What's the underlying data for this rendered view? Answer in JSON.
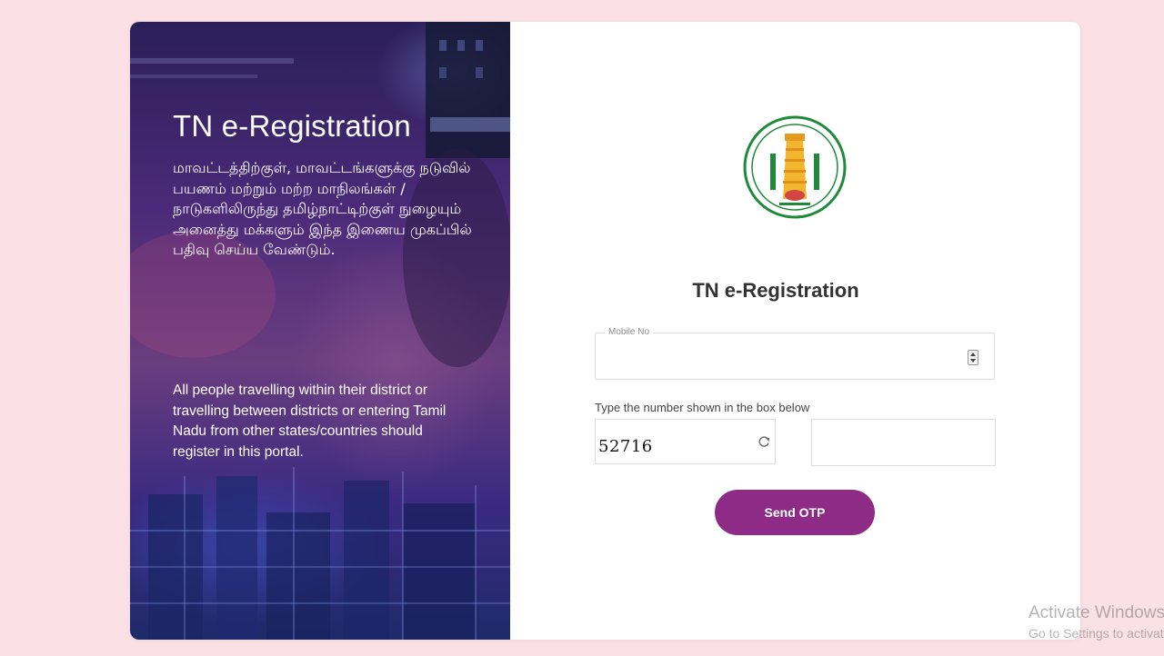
{
  "hero": {
    "title": "TN e-Registration",
    "tamil_text": "மாவட்டத்திற்குள், மாவட்டங்களுக்கு நடுவில் பயணம் மற்றும் மற்ற மாநிலங்கள் / நாடுகளிலிருந்து தமிழ்நாட்டிற்குள் நுழையும் அனைத்து மக்களும் இந்த இணைய முகப்பில் பதிவு செய்ய வேண்டும்.",
    "english_text": "All people travelling within their district or travelling between districts or entering Tamil Nadu from other states/countries should register in this portal."
  },
  "form": {
    "emblem_icon": "tamil-nadu-government-emblem",
    "title": "TN e-Registration",
    "mobile": {
      "label": "Mobile No",
      "value": "",
      "placeholder": ""
    },
    "captcha": {
      "instruction": "Type the number shown in the box below",
      "code": "52716",
      "refresh_icon": "refresh-icon",
      "answer_value": "",
      "answer_placeholder": ""
    },
    "send_otp_label": "Send OTP"
  },
  "watermark": {
    "line1": "Activate Windows",
    "line2": "Go to Settings to activate Windows."
  },
  "colors": {
    "page_background": "#fbe0e6",
    "card_background": "#ffffff",
    "button_background": "#8d2b86",
    "hero_gradient_top": "#2b1f58",
    "hero_gradient_bottom": "#1f2a6a",
    "emblem_green": "#1e8a3a",
    "emblem_gold": "#f2b62e"
  }
}
